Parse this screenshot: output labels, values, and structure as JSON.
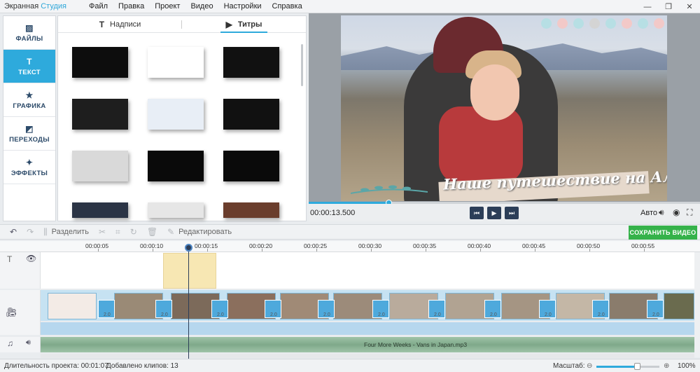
{
  "app": {
    "title_main": "Экранная ",
    "title_accent": "Студия"
  },
  "menu": [
    "Файл",
    "Правка",
    "Проект",
    "Видео",
    "Настройки",
    "Справка"
  ],
  "window": {
    "minimize": "—",
    "maximize": "❐",
    "close": "✕"
  },
  "sidebar": [
    {
      "label": "ФАЙЛЫ",
      "icon": "image-icon",
      "glyph": "▨",
      "active": false
    },
    {
      "label": "ТЕКСТ",
      "icon": "text-icon",
      "glyph": "T",
      "active": true
    },
    {
      "label": "ГРАФИКА",
      "icon": "star-icon",
      "glyph": "★",
      "active": false
    },
    {
      "label": "ПЕРЕХОДЫ",
      "icon": "transitions-icon",
      "glyph": "◩",
      "active": false
    },
    {
      "label": "ЭФФЕКТЫ",
      "icon": "magic-wand-icon",
      "glyph": "✦",
      "active": false
    }
  ],
  "library": {
    "tabs": [
      {
        "label": "Надписи",
        "glyph": "T",
        "active": false
      },
      {
        "label": "Титры",
        "glyph": "▶",
        "active": true
      }
    ],
    "thumb_colors": [
      "#0d0d0d",
      "#ffffff",
      "#111111",
      "#1e1e1e",
      "#e8eef6",
      "#111111",
      "#d9d9d9",
      "#0a0a0a",
      "#0a0a0a",
      "#2b3445",
      "#e6e6e6",
      "#6a3d2c"
    ]
  },
  "preview": {
    "title_text": "Наше путешествие на Алтай",
    "dot_colors": [
      "#b7dfe4",
      "#f2c9c8",
      "#b7dfe4",
      "#d4d4d4",
      "#b7dfe4",
      "#f2c9c8",
      "#b7dfe4",
      "#f2c9c8"
    ],
    "timecode": "00:00:13.500",
    "progress_fraction": 0.205,
    "prev_glyph": "⏮",
    "play_glyph": "▶",
    "next_glyph": "⏭",
    "auto_label": "Авто"
  },
  "toolbar": {
    "split_label": "Разделить",
    "edit_label": "Редактировать",
    "save_label": "СОХРАНИТЬ ВИДЕО"
  },
  "timeline": {
    "ticks": [
      "00:00:05",
      "00:00:10",
      "00:00:15",
      "00:00:20",
      "00:00:25",
      "00:00:30",
      "00:00:35",
      "00:00:40",
      "00:00:45",
      "00:00:50",
      "00:00:55"
    ],
    "transition_label": "2.0",
    "audio_file": "Four More Weeks - Vans in Japan.mp3"
  },
  "status": {
    "duration_label": "Длительность проекта: 00:01:07",
    "clips_label": "Добавлено клипов: 13",
    "zoom_label": "Масштаб:",
    "zoom_value": "100%",
    "zoom_fraction": 0.65
  }
}
